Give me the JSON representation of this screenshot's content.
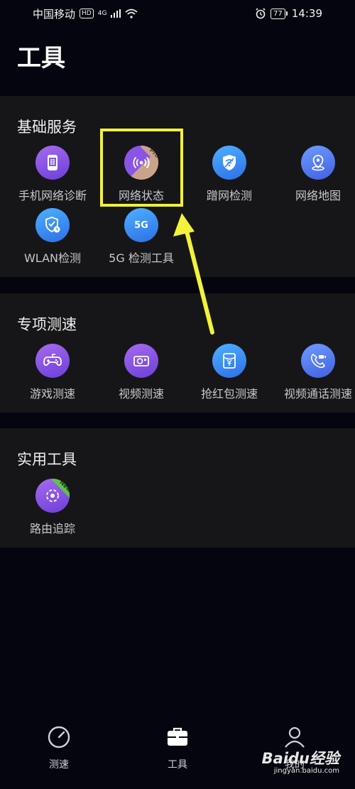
{
  "status_bar": {
    "carrier": "中国移动",
    "hd": "HD",
    "network": "4G",
    "battery": "77",
    "time": "14:39"
  },
  "page": {
    "title": "工具"
  },
  "sections": {
    "basic": {
      "title": "基础服务",
      "items": [
        {
          "label": "手机网络诊断",
          "icon": "phone-diagnosis-icon"
        },
        {
          "label": "网络状态",
          "icon": "network-status-icon",
          "badge": "Pro"
        },
        {
          "label": "蹭网检测",
          "icon": "shield-wifi-icon"
        },
        {
          "label": "网络地图",
          "icon": "map-pin-icon"
        },
        {
          "label": "WLAN检测",
          "icon": "wlan-shield-icon"
        },
        {
          "label": "5G 检测工具",
          "icon": "5g-icon",
          "icon_text": "5G"
        }
      ]
    },
    "special": {
      "title": "专项测速",
      "items": [
        {
          "label": "游戏测速",
          "icon": "gamepad-icon"
        },
        {
          "label": "视频测速",
          "icon": "video-camera-icon"
        },
        {
          "label": "抢红包测速",
          "icon": "red-envelope-icon"
        },
        {
          "label": "视频通话测速",
          "icon": "video-call-icon"
        }
      ]
    },
    "utility": {
      "title": "实用工具",
      "items": [
        {
          "label": "路由追踪",
          "icon": "route-trace-icon",
          "badge": "New"
        }
      ]
    }
  },
  "nav": {
    "items": [
      {
        "label": "测速",
        "icon": "speedometer-icon"
      },
      {
        "label": "工具",
        "icon": "toolbox-icon"
      },
      {
        "label": "我的",
        "icon": "profile-icon"
      }
    ]
  },
  "watermark": {
    "main": "Baidu经验",
    "sub": "jingyan.baidu.com"
  },
  "colors": {
    "background": "#05050f",
    "section_bg": "#161618",
    "highlight": "#f2f23a",
    "icon_purple": "#8a55e6",
    "icon_blue": "#3d8ff0"
  }
}
